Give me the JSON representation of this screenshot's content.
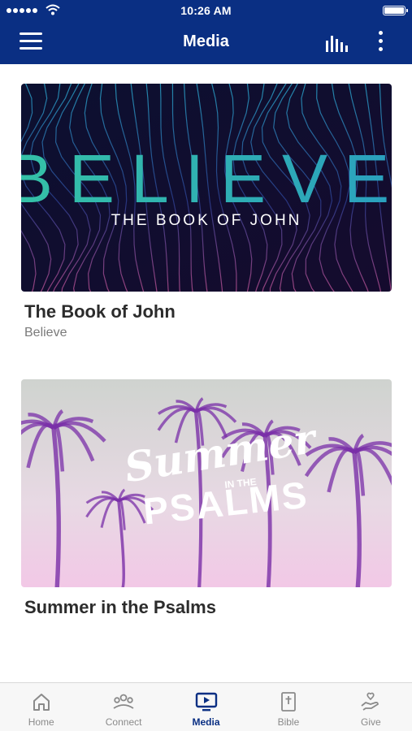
{
  "status_bar": {
    "time": "10:26 AM"
  },
  "header": {
    "title": "Media"
  },
  "cards": [
    {
      "art_title": "BELIEVE",
      "art_subtitle": "THE BOOK OF JOHN",
      "title": "The Book of John",
      "subtitle": "Believe"
    },
    {
      "art_script": "Summer",
      "art_small": "IN THE",
      "art_big": "PSALMS",
      "title": "Summer in the Psalms"
    }
  ],
  "tabs": [
    {
      "label": "Home",
      "icon": "home-icon",
      "active": false
    },
    {
      "label": "Connect",
      "icon": "people-icon",
      "active": false
    },
    {
      "label": "Media",
      "icon": "tv-play-icon",
      "active": true
    },
    {
      "label": "Bible",
      "icon": "bible-icon",
      "active": false
    },
    {
      "label": "Give",
      "icon": "hand-heart-icon",
      "active": false
    }
  ],
  "colors": {
    "brand": "#0a2f83",
    "tab_inactive": "#8a8a8a",
    "believe_teal": "#2fb8a6"
  }
}
